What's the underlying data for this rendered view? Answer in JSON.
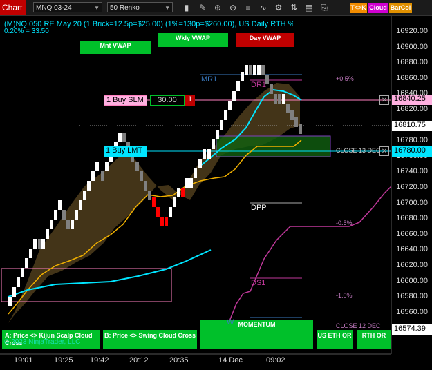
{
  "toolbar": {
    "title": "Chart",
    "instrument": "MNQ 03-24",
    "bar_type": "50 Renko",
    "icons": [
      "bar-style-icon",
      "pencil-icon",
      "zoom-in-icon",
      "zoom-out-icon",
      "properties-icon",
      "indicators-icon",
      "strategy-icon",
      "trade-icon",
      "data-box-icon",
      "attach-icon"
    ],
    "chips": [
      {
        "label": "T<>K",
        "color": "#f28c00"
      },
      {
        "label": "Cloud",
        "color": "#d000d0"
      },
      {
        "label": "BarCol",
        "color": "#e09000"
      }
    ]
  },
  "header": {
    "line1": "(M)NQ 050 RE May 20 (1 Brick=12.5p=$25.00) (1%=130p=$260.00), US Daily RTH %",
    "line2": "0.20% = 33.50"
  },
  "vwap_buttons": [
    {
      "label": "Mnt VWAP",
      "color": "#00c02a"
    },
    {
      "label": "Wkly VWAP",
      "color": "#00c02a"
    },
    {
      "label": "Day VWAP",
      "color": "#c00000"
    }
  ],
  "orders": {
    "buy_slm": {
      "label": "1 Buy SLM",
      "value": "30.00",
      "close": "1",
      "price": "16840.25"
    },
    "buy_lmt": {
      "label": "1 Buy LMT",
      "price": "16780.00"
    }
  },
  "last_price": "16810.75",
  "bottom_price": "16574.39",
  "price_axis": [
    "16920.00",
    "16900.00",
    "16880.00",
    "16860.00",
    "16840.00",
    "16820.00",
    "16800.00",
    "16780.00",
    "16760.00",
    "16740.00",
    "16720.00",
    "16700.00",
    "16680.00",
    "16660.00",
    "16640.00",
    "16620.00",
    "16600.00",
    "16580.00",
    "16560.00"
  ],
  "time_axis": [
    "19:01",
    "19:25",
    "19:42",
    "20:12",
    "20:35",
    "14 Dec",
    "09:02"
  ],
  "pivots": {
    "mr1": "MR1",
    "dr1": "DR1",
    "dpp": "DPP",
    "ds1": "DS1"
  },
  "pct_labels": [
    "+0.5%",
    "-0.5%",
    "-1.0%"
  ],
  "close_labels": [
    "CLOSE 13 DEC",
    "CLOSE 12 DEC"
  ],
  "bottom_buttons": [
    {
      "label": "A: Price <> Kijun Scalp Cloud Cross"
    },
    {
      "label": "B: Price <> Swing Cloud Cross"
    },
    {
      "label": "MOMENTUM"
    },
    {
      "label": "US ETH OR"
    },
    {
      "label": "RTH OR"
    }
  ],
  "momentum_overlay": "W",
  "copyright": "© 2023 NinjaTrader, LLC",
  "colors": {
    "up": "#ffffff",
    "down": "#808080",
    "strong_down": "#ff0000",
    "cyan": "#00e5ff",
    "gold": "#f0b000",
    "magenta": "#c0389a"
  }
}
